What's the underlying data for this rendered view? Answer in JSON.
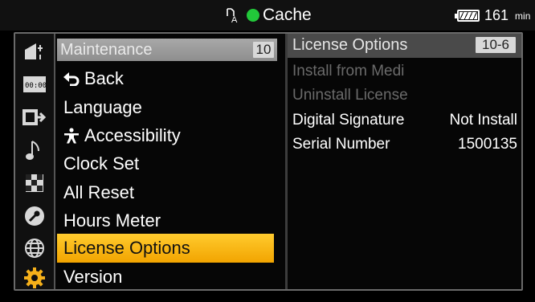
{
  "status": {
    "media_label": "Cache",
    "battery_value": "161",
    "battery_unit": "min",
    "colors": {
      "record_dot": "#22c83a"
    }
  },
  "sidebar": {
    "icons": [
      "camera-icon",
      "timecode-icon",
      "output-icon",
      "audio-icon",
      "checker-icon",
      "wrench-icon",
      "globe-icon",
      "gear-icon"
    ],
    "active": "gear-icon"
  },
  "menu": {
    "title": "Maintenance",
    "title_badge": "10",
    "items": [
      {
        "label": "Back",
        "icon": "back-arrow-icon"
      },
      {
        "label": "Language"
      },
      {
        "label": "Accessibility",
        "icon": "accessibility-icon"
      },
      {
        "label": "Clock Set"
      },
      {
        "label": "All Reset"
      },
      {
        "label": "Hours Meter"
      },
      {
        "label": "License Options",
        "selected": true
      },
      {
        "label": "Version"
      }
    ],
    "colors": {
      "selected": "#f7b718"
    }
  },
  "detail": {
    "title": "License Options",
    "title_badge": "10-6",
    "rows": [
      {
        "label": "Install from Medi",
        "value": "",
        "disabled": true
      },
      {
        "label": "Uninstall License",
        "value": "",
        "disabled": true
      },
      {
        "label": "Digital Signature",
        "value": "Not Install",
        "disabled": false
      },
      {
        "label": "Serial Number",
        "value": "1500135",
        "disabled": false
      }
    ]
  }
}
